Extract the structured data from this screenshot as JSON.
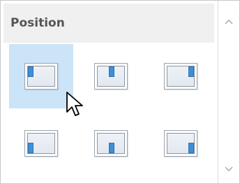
{
  "panel": {
    "header": {
      "title": "Position"
    },
    "grid": {
      "selected_index": 0,
      "items": [
        {
          "name": "top-left-icon",
          "placement": "top-left"
        },
        {
          "name": "top-center-icon",
          "placement": "top-center"
        },
        {
          "name": "top-right-icon",
          "placement": "top-right"
        },
        {
          "name": "bottom-left-icon",
          "placement": "bottom-left"
        },
        {
          "name": "bottom-center-icon",
          "placement": "bottom-center"
        },
        {
          "name": "bottom-right-icon",
          "placement": "bottom-right"
        }
      ]
    },
    "scrollbar": {
      "up_icon": "chevron-up-icon",
      "down_icon": "chevron-down-icon"
    }
  },
  "colors": {
    "selection": "#cce4f7",
    "header_bg": "#f0f0f0",
    "accent_blue": "#3d8fd8"
  },
  "cursor": {
    "icon": "arrow-cursor-icon"
  }
}
